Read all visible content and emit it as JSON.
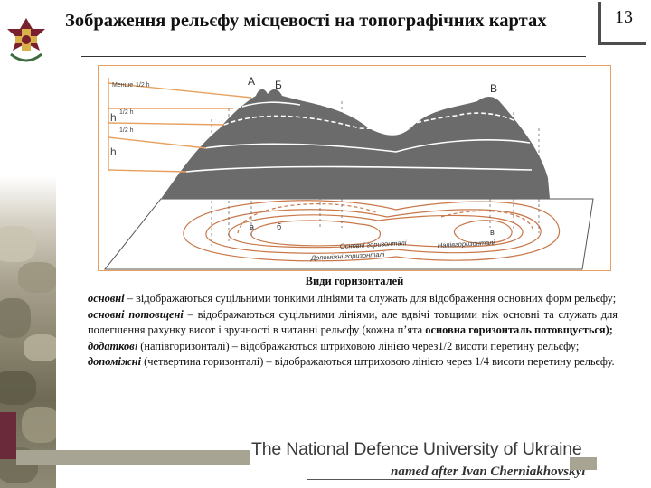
{
  "slide": {
    "title": "Зображення рельєфу місцевості на топографічних картах",
    "page_number": "13"
  },
  "diagram": {
    "top_points": [
      "А",
      "Б",
      "В"
    ],
    "map_points": [
      "а",
      "б",
      "в"
    ],
    "scale_labels": {
      "less_half": "Менше",
      "less_half_fraction": "1/2 h",
      "h_big": "h",
      "half_1": "1/2 h",
      "half_2": "1/2 h",
      "h_lower": "h"
    },
    "legend": {
      "main": "Основні горизонталі",
      "half": "Напівгоризонталі",
      "aux": "Допоміжні горизонталі"
    }
  },
  "caption": "Види горизонталей",
  "definitions": [
    {
      "term": "основні",
      "text": " – відображаються суцільними тонкими лініями та служать для відображення основних форм рельєфу;"
    },
    {
      "term": "основні потовщені",
      "text": " – відображаються суцільними лініями, але вдвічі товщими ніж основні та служать для полегшення рахунку висот і зручності в читанні рельєфу (кожна п’ята ",
      "bold_tail": "основна горизонталь потовщується);"
    },
    {
      "term": "додатков",
      "term_suffix": "і",
      "text": " (напівгоризонталі) – відображаються штриховою лінією через1/2 висоти перетину рельєфу;"
    },
    {
      "term": "допоміжні",
      "text": " (четвертина горизонталі) – відображаються штриховою лінією через 1/4 висоти перетину рельєфу."
    }
  ],
  "footer": {
    "university": "The National Defence University of Ukraine",
    "named_after": "named after Ivan Cherniakhovskyi"
  },
  "colors": {
    "terrain": "#6b6b6b",
    "contour": "#c8784a",
    "frame": "#e8a060",
    "map_plane": "#ffffff"
  }
}
